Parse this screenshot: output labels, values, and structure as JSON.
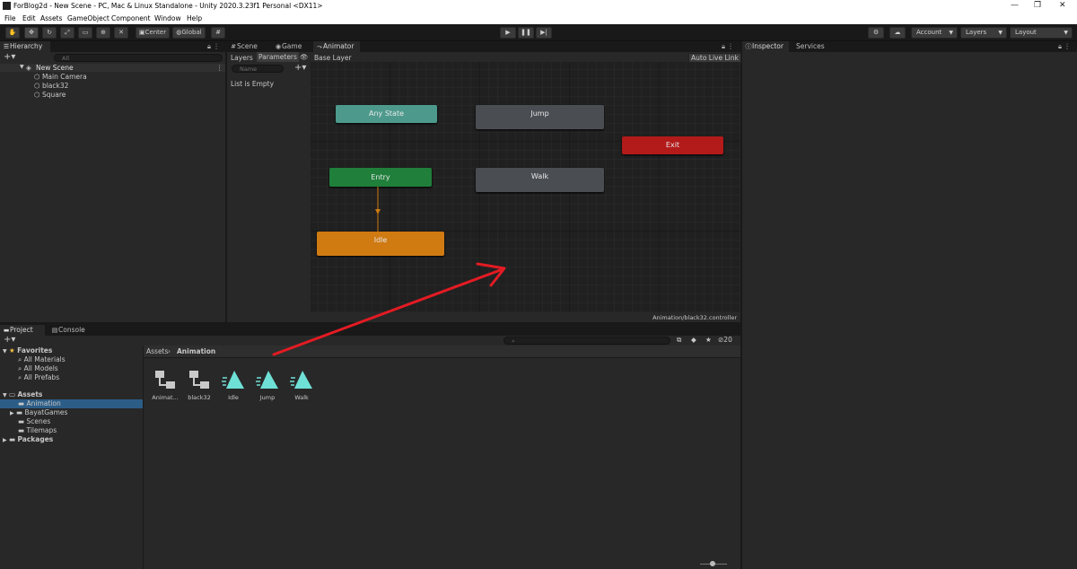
{
  "window": {
    "title": "ForBlog2d - New Scene - PC, Mac & Linux Standalone - Unity 2020.3.23f1 Personal <DX11>"
  },
  "menu": [
    "File",
    "Edit",
    "Assets",
    "GameObject",
    "Component",
    "Window",
    "Help"
  ],
  "toolbar": {
    "center_label": "Center",
    "global_label": "Global",
    "account_label": "Account",
    "layers_label": "Layers",
    "layout_label": "Layout"
  },
  "hierarchy": {
    "tab": "Hierarchy",
    "search_placeholder": "All",
    "scene": "New Scene",
    "items": [
      "Main Camera",
      "black32",
      "Square"
    ]
  },
  "animator": {
    "tabs": [
      "Scene",
      "Game",
      "Animator"
    ],
    "layers_tab": "Layers",
    "parameters_tab": "Parameters",
    "base_layer": "Base Layer",
    "auto_live_link": "Auto Live Link",
    "name_placeholder": "Name",
    "list_empty": "List is Empty",
    "nodes": {
      "any_state": "Any State",
      "jump": "Jump",
      "exit": "Exit",
      "entry": "Entry",
      "walk": "Walk",
      "idle": "Idle"
    },
    "footer_path": "Animation/black32.controller"
  },
  "inspector": {
    "tabs": [
      "Inspector",
      "Services"
    ]
  },
  "project": {
    "tabs": [
      "Project",
      "Console"
    ],
    "favorites": "Favorites",
    "favorite_items": [
      "All Materials",
      "All Models",
      "All Prefabs"
    ],
    "assets": "Assets",
    "asset_folders": [
      "Animation",
      "BayatGames",
      "Scenes",
      "Tilemaps"
    ],
    "packages": "Packages",
    "breadcrumb": [
      "Assets",
      "Animation"
    ],
    "hidden_count": "20",
    "files": [
      {
        "name": "Animat...",
        "type": "controller"
      },
      {
        "name": "black32",
        "type": "controller"
      },
      {
        "name": "Idle",
        "type": "clip"
      },
      {
        "name": "Jump",
        "type": "clip"
      },
      {
        "name": "Walk",
        "type": "clip"
      }
    ]
  },
  "colors": {
    "accent_selection": "#2c5d87",
    "any_state": "#4d9a8d",
    "entry": "#1f7f3b",
    "exit": "#b31a1a",
    "idle": "#d07a12",
    "default_state": "#4a4d52",
    "annotation_arrow": "#e31b23"
  }
}
